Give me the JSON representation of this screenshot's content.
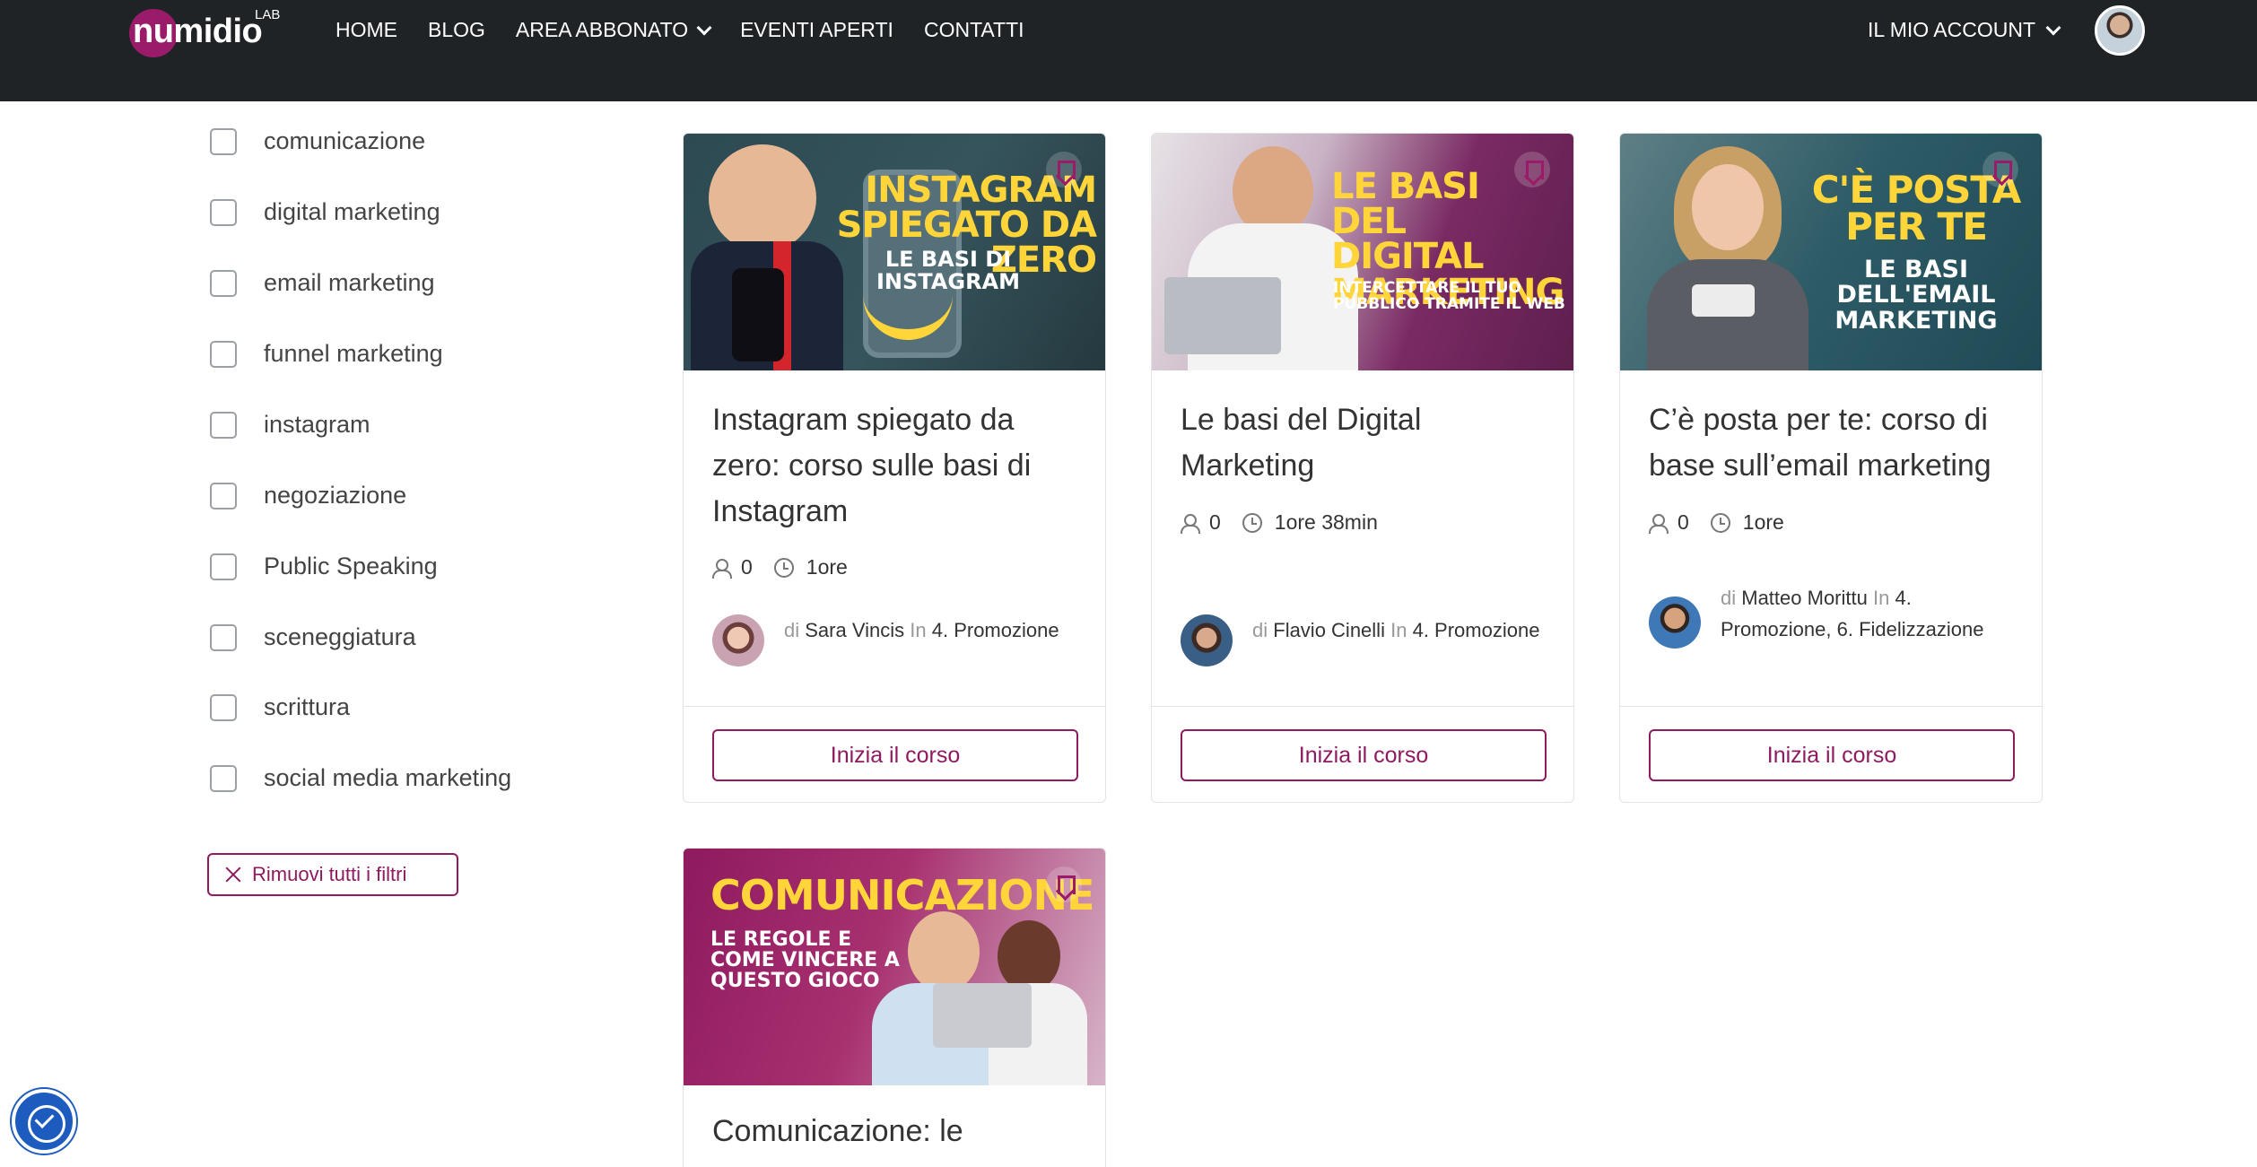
{
  "header": {
    "logo_text": "numidio",
    "logo_suffix": "LAB",
    "nav": [
      {
        "label": "HOME"
      },
      {
        "label": "BLOG"
      },
      {
        "label": "AREA ABBONATO"
      },
      {
        "label": "EVENTI APERTI"
      },
      {
        "label": "CONTATTI"
      }
    ],
    "account_label": "IL MIO ACCOUNT"
  },
  "filters": {
    "items": [
      "comunicazione",
      "digital marketing",
      "email marketing",
      "funnel marketing",
      "instagram",
      "negoziazione",
      "Public Speaking",
      "sceneggiatura",
      "scrittura",
      "social media marketing"
    ],
    "clear_label": "Rimuovi tutti i filtri"
  },
  "courses": [
    {
      "thumb_headline": "INSTAGRAM SPIEGATO DA ZERO",
      "thumb_sub": "LE BASI DI INSTAGRAM",
      "title": "Instagram spiegato da zero: corso sulle basi di Instagram",
      "students": "0",
      "duration": "1ore",
      "by": "di",
      "author": "Sara Vincis",
      "in": "In",
      "categories": "4. Promozione",
      "button": "Inizia il corso"
    },
    {
      "thumb_headline": "LE BASI DEL DIGITAL MARKETING",
      "thumb_sub": "INTERCETTARE IL TUO PUBBLICO TRAMITE IL WEB",
      "title": "Le basi del Digital Marketing",
      "students": "0",
      "duration": "1ore 38min",
      "by": "di",
      "author": "Flavio Cinelli",
      "in": "In",
      "categories": "4. Promozione",
      "button": "Inizia il corso"
    },
    {
      "thumb_headline": "C'È POSTA PER TE",
      "thumb_sub": "LE BASI DELL'EMAIL MARKETING",
      "title": "C’è posta per te: corso di base sull’email marketing",
      "students": "0",
      "duration": "1ore",
      "by": "di",
      "author": "Matteo Morittu",
      "in": "In",
      "categories": "4. Promozione, 6. Fidelizzazione",
      "button": "Inizia il corso"
    },
    {
      "thumb_headline": "COMUNICAZIONE",
      "thumb_sub": "LE REGOLE E COME VINCERE A QUESTO GIOCO",
      "title": "Comunicazione: le"
    }
  ],
  "colors": {
    "accent": "#8e1a5f",
    "header_bg": "#1f2326",
    "thumb_yellow": "#ffd53a"
  }
}
